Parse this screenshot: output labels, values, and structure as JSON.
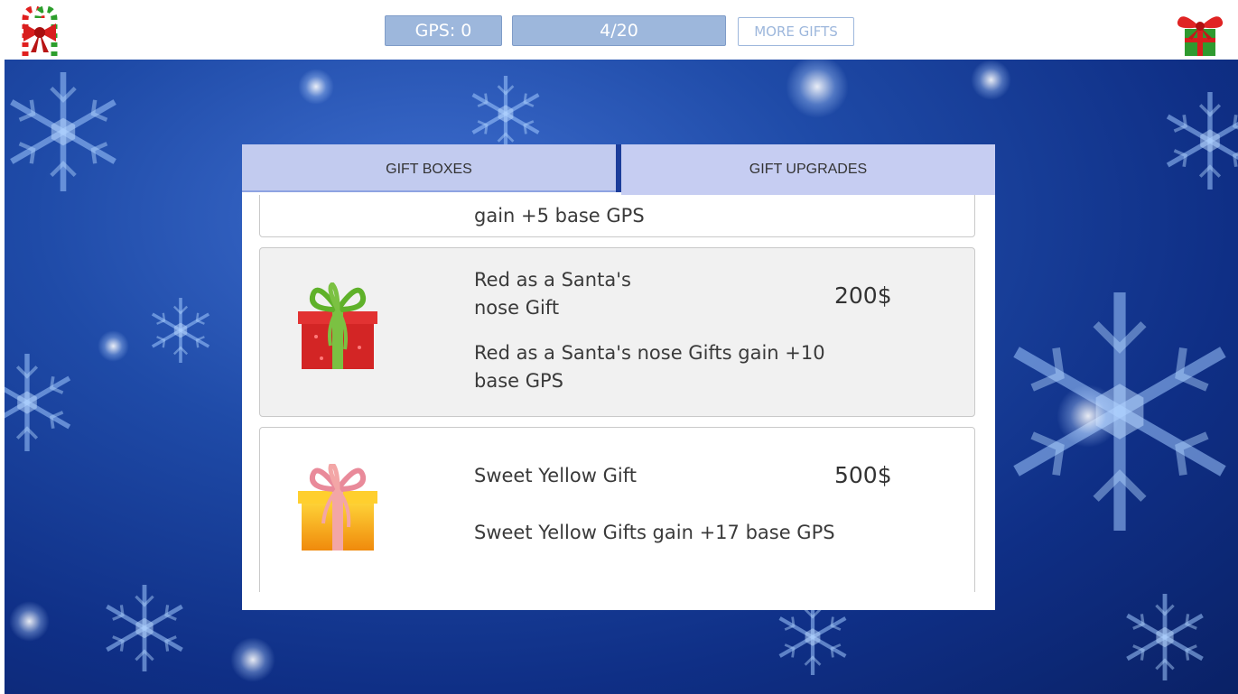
{
  "header": {
    "gps_label": "GPS: 0",
    "progress_label": "4/20",
    "progress_fraction": 0.2,
    "more_gifts_label": "MORE GIFTS",
    "left_icon": "candy-cane-bow-icon",
    "right_icon": "gift-box-icon"
  },
  "tabs": [
    {
      "label": "GIFT BOXES"
    },
    {
      "label": "GIFT UPGRADES"
    }
  ],
  "items": [
    {
      "name": "",
      "price": "",
      "desc": "gain +5 base GPS",
      "color": "#c73a3a"
    },
    {
      "name": "Red as a Santa's nose Gift",
      "price": "200$",
      "desc": "Red as a Santa's nose Gifts gain +10 base GPS",
      "color": "#d32525"
    },
    {
      "name": "Sweet Yellow Gift",
      "price": "500$",
      "desc": "Sweet Yellow Gifts gain +17 base GPS",
      "color": "#f5b70f"
    }
  ],
  "colors": {
    "pill": "#9db7dc",
    "background": "#1f4ba8",
    "tab": "#c2cbef"
  }
}
